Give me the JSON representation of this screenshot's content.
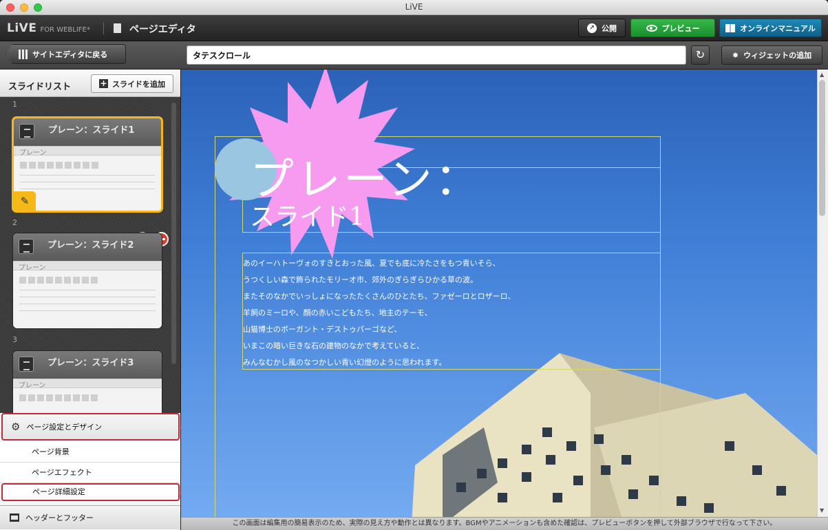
{
  "window": {
    "title": "LiVE"
  },
  "app": {
    "logo": "LiVE",
    "logo_sub": "FOR WEBLIFE*",
    "page_label": "ページエディタ",
    "publish_label": "公開",
    "preview_label": "プレビュー",
    "manual_label": "オンラインマニュアル"
  },
  "toolbar": {
    "back_label": "サイトエディタに戻る",
    "page_title_value": "タテスクロール",
    "add_widget_label": "ウィジェットの追加"
  },
  "slidelist": {
    "title": "スライドリスト",
    "add_label": "スライドを追加",
    "slides": [
      {
        "num": "1",
        "title": "プレーン：スライド1",
        "layout": "プレーン"
      },
      {
        "num": "2",
        "title": "プレーン：スライド2",
        "layout": "プレーン"
      },
      {
        "num": "3",
        "title": "プレーン：スライド3",
        "layout": "プレーン"
      }
    ]
  },
  "settings": {
    "main_label": "ページ設定とデザイン",
    "items": [
      "ページ背景",
      "ページエフェクト",
      "ページ詳細設定"
    ],
    "header_footer_label": "ヘッダーとフッター"
  },
  "callouts": [
    "1",
    "2"
  ],
  "canvas": {
    "heading_line1": "プレーン：",
    "heading_line2": "スライド1",
    "body_lines": [
      "あのイーハトーヴォのすきとおった風、夏でも底に冷たさをもつ青いそら、",
      "うつくしい森で飾られたモリーオ市、郊外のぎらぎらひかる草の波。",
      "またそのなかでいっしょになったたくさんのひとたち、ファゼーロとロザーロ、",
      "羊飼のミーロや、顔の赤いこどもたち、地主のテーモ、",
      "山猫博士のボーガント・デストゥパーゴなど、",
      "いまこの暗い巨きな石の建物のなかで考えていると、",
      "みんなむかし風のなつかしい青い幻燈のように思われます。"
    ]
  },
  "status": {
    "text": "この画面は編集用の簡易表示のため、実際の見え方や動作とは異なります。BGMやアニメーションも含めた確認は、プレビューボタンを押して外部ブラウザで行なって下さい。"
  },
  "colors": {
    "accent_callout": "#c4142c",
    "preview_green": "#22a036",
    "manual_blue": "#1577a4",
    "selected_slide": "#f6b817"
  }
}
